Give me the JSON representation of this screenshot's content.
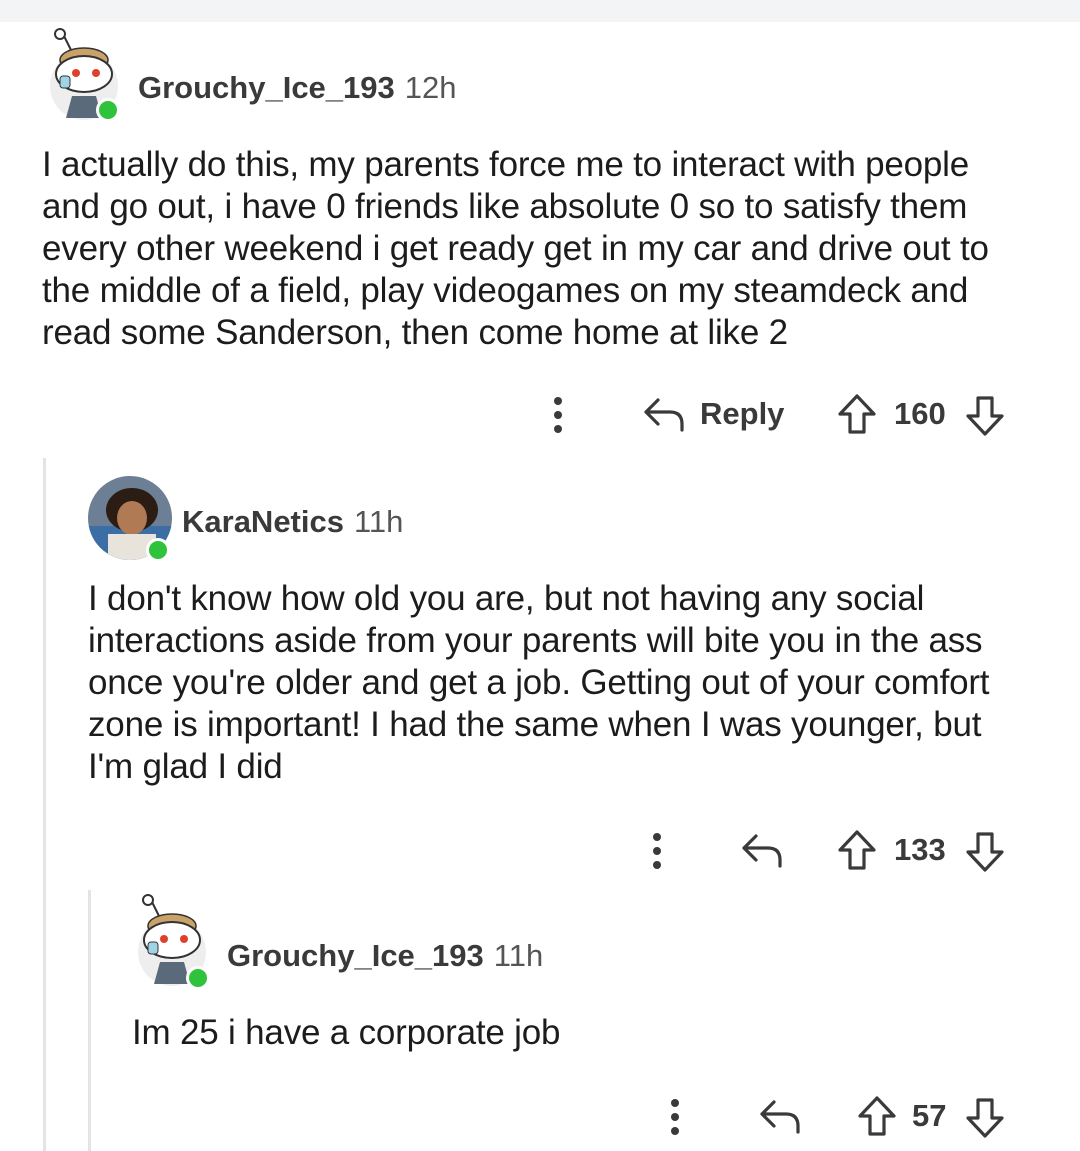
{
  "comments": [
    {
      "username": "Grouchy_Ice_193",
      "time": "12h",
      "lines": [
        "I actually do this, my parents force me to interact with people",
        "and go out, i have 0 friends like absolute 0 so to satisfy them",
        "every other weekend i get ready get in my car and drive out to",
        "the middle of a field, play videogames on my steamdeck and",
        "read some Sanderson, then come home at like 2"
      ],
      "reply_label": "Reply",
      "score": "160"
    },
    {
      "username": "KaraNetics",
      "time": "11h",
      "lines": [
        "I don't know how old you are, but not having any social",
        "interactions aside from your parents will bite you in the ass",
        "once you're older and get a job. Getting out of your comfort",
        "zone is important! I had the same when I was younger, but",
        "I'm glad I did"
      ],
      "score": "133"
    },
    {
      "username": "Grouchy_Ice_193",
      "time": "11h",
      "lines": [
        "Im 25 i have a corporate job"
      ],
      "score": "57"
    }
  ],
  "colors": {
    "online": "#2fc33d",
    "thread_line": "#e4e4e4",
    "text": "#1c1c1c"
  },
  "icons": [
    "more-vertical-icon",
    "reply-arrow-icon",
    "upvote-arrow-icon",
    "downvote-arrow-icon",
    "online-status-icon"
  ]
}
